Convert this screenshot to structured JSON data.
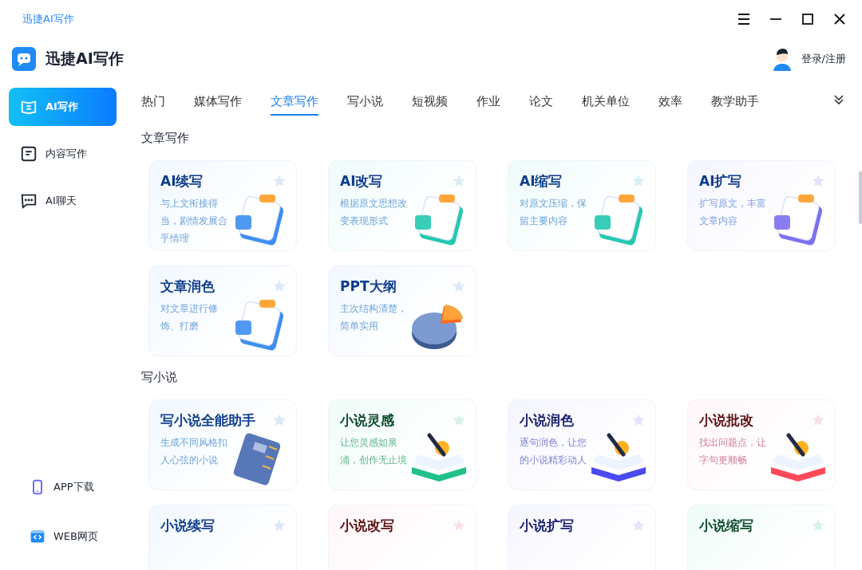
{
  "window": {
    "title": "迅捷AI写作"
  },
  "app": {
    "name": "迅捷AI写作"
  },
  "user": {
    "label": "登录/注册"
  },
  "sidebar": {
    "items": [
      {
        "label": "AI写作",
        "selected": true
      },
      {
        "label": "内容写作",
        "selected": false
      },
      {
        "label": "AI聊天",
        "selected": false
      }
    ],
    "footer_items": [
      {
        "label": "APP下载"
      },
      {
        "label": "WEB网页"
      }
    ]
  },
  "tabs": [
    {
      "label": "热门",
      "selected": false
    },
    {
      "label": "媒体写作",
      "selected": false
    },
    {
      "label": "文章写作",
      "selected": true
    },
    {
      "label": "写小说",
      "selected": false
    },
    {
      "label": "短视频",
      "selected": false
    },
    {
      "label": "作业",
      "selected": false
    },
    {
      "label": "论文",
      "selected": false
    },
    {
      "label": "机关单位",
      "selected": false
    },
    {
      "label": "效率",
      "selected": false
    },
    {
      "label": "教学助手",
      "selected": false
    }
  ],
  "sections": [
    {
      "title": "文章写作",
      "cards": [
        {
          "title": "AI续写",
          "description": "与上文衔接得当，剧情发展合乎情理",
          "kind": "blue"
        },
        {
          "title": "AI改写",
          "description": "根据原文思想改变表现形式",
          "kind": "teal"
        },
        {
          "title": "AI缩写",
          "description": "对原文压缩，保留主要内容",
          "kind": "teal"
        },
        {
          "title": "AI扩写",
          "description": "扩写原文，丰富文章内容",
          "kind": "violet"
        },
        {
          "title": "文章润色",
          "description": "对文章进行修饰、打磨",
          "kind": "blue"
        },
        {
          "title": "PPT大纲",
          "description": "主次结构清楚，简单实用",
          "kind": "blue"
        }
      ]
    },
    {
      "title": "写小说",
      "cards": [
        {
          "title": "写小说全能助手",
          "description": "生成不同风格扣人心弦的小说",
          "kind": "blue"
        },
        {
          "title": "小说灵感",
          "description": "让您灵感如泉涌，创作无止境",
          "kind": "green"
        },
        {
          "title": "小说润色",
          "description": "逐句润色，让您的小说精彩动人",
          "kind": "indigo"
        },
        {
          "title": "小说批改",
          "description": "找出问题点，让字句更顺畅",
          "kind": "rose"
        },
        {
          "title": "小说续写",
          "kind": "blue"
        },
        {
          "title": "小说改写",
          "kind": "rose"
        },
        {
          "title": "小说扩写",
          "kind": "indigo"
        },
        {
          "title": "小说缩写",
          "kind": "green"
        }
      ]
    }
  ]
}
